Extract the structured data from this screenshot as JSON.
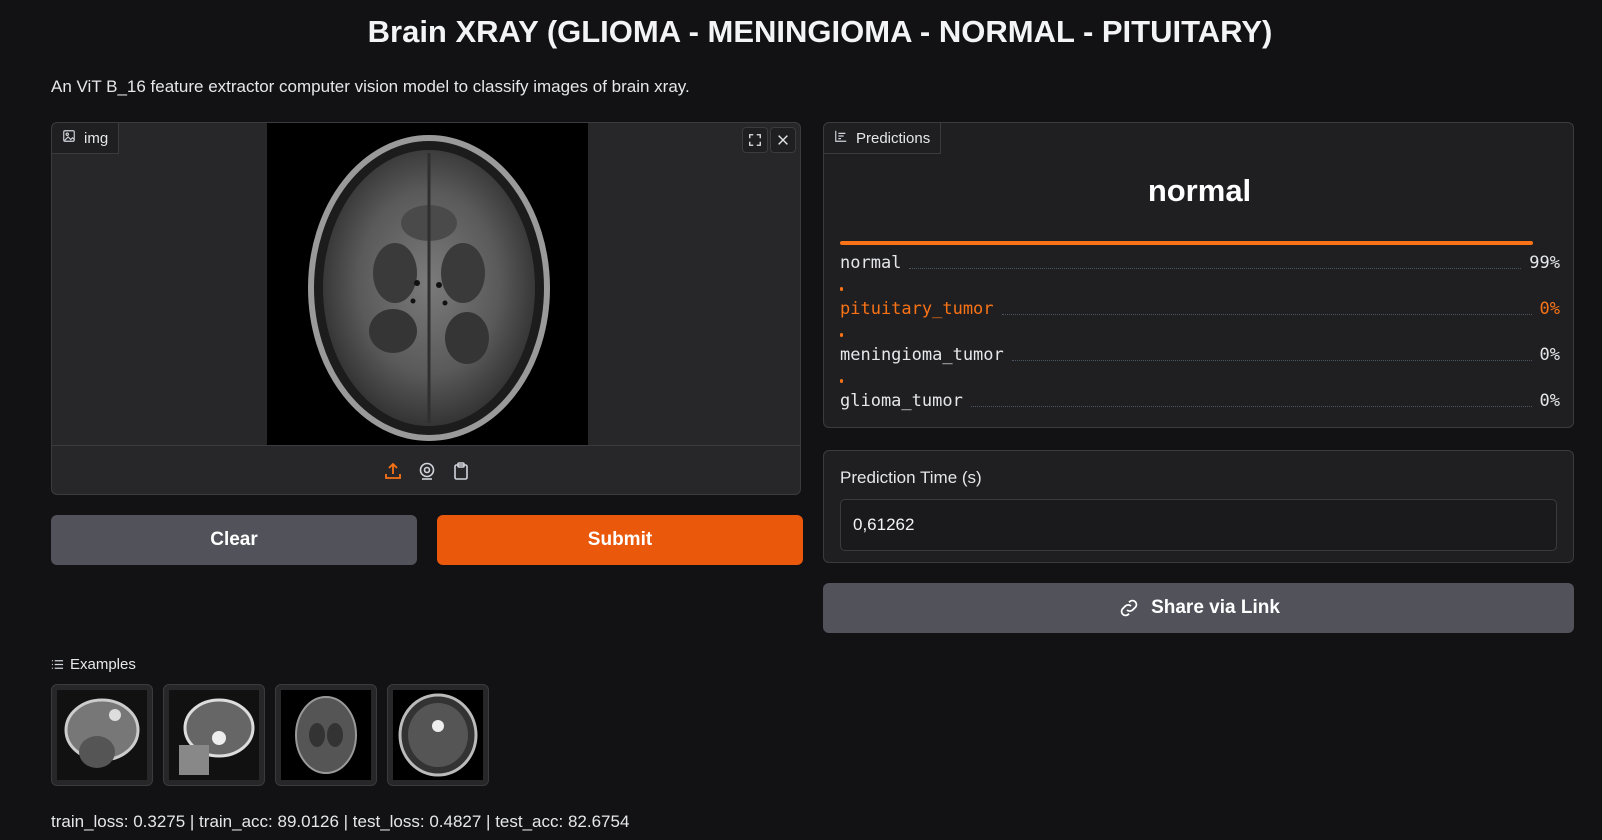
{
  "page": {
    "title": "Brain XRAY (GLIOMA - MENINGIOMA - NORMAL - PITUITARY)",
    "description": "An ViT B_16 feature extractor computer vision model to classify images of brain xray."
  },
  "input": {
    "label": "img",
    "icon": "image-icon",
    "corner_icons": [
      "fullscreen-icon",
      "close-icon"
    ],
    "toolbar_icons": [
      "upload-icon",
      "webcam-icon",
      "clipboard-icon"
    ]
  },
  "buttons": {
    "clear": "Clear",
    "submit": "Submit",
    "share": "Share via Link"
  },
  "predictions": {
    "label": "Predictions",
    "icon": "bar-chart-icon",
    "top_label": "normal",
    "rows": [
      {
        "name": "normal",
        "value": "99%",
        "confidence": 0.99
      },
      {
        "name": "pituitary_tumor",
        "value": "0%",
        "confidence": 0.0
      },
      {
        "name": "meningioma_tumor",
        "value": "0%",
        "confidence": 0.0
      },
      {
        "name": "glioma_tumor",
        "value": "0%",
        "confidence": 0.0
      }
    ]
  },
  "prediction_time": {
    "label": "Prediction Time (s)",
    "value": "0,61262"
  },
  "examples": {
    "label": "Examples",
    "icon": "list-icon",
    "count": 4
  },
  "footer": {
    "metrics": "train_loss: 0.3275 | train_acc: 89.0126 | test_loss: 0.4827 | test_acc: 82.6754"
  },
  "colors": {
    "accent": "#ea580c",
    "bar": "#f97316",
    "neutral_button": "#52525b",
    "background": "#121214"
  }
}
